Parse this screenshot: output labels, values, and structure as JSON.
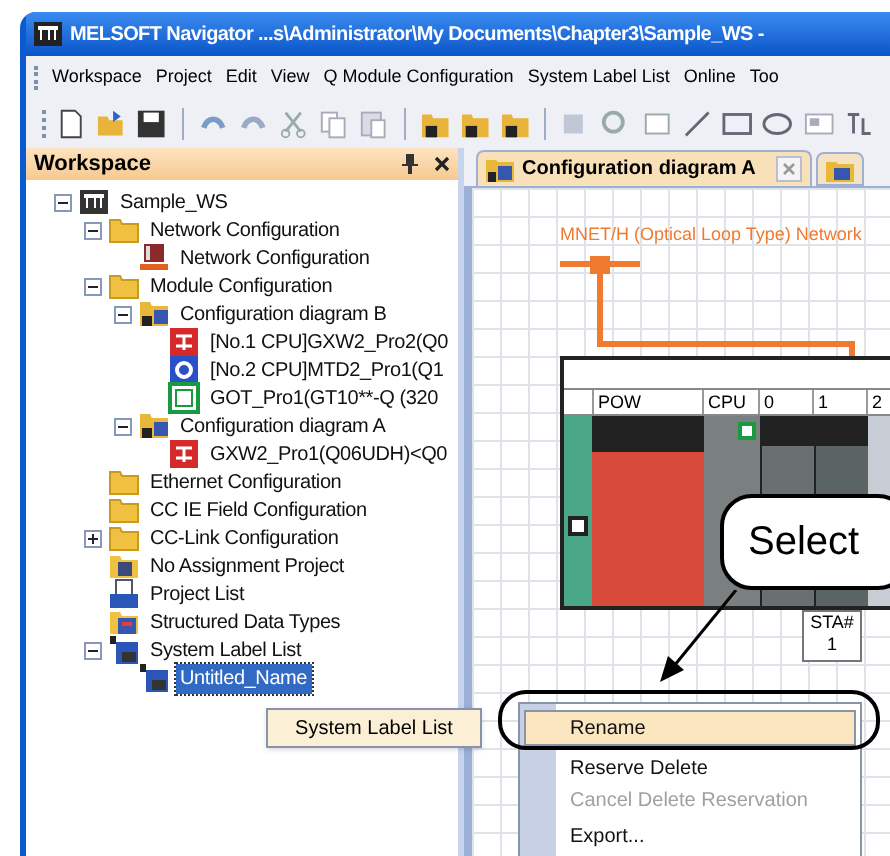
{
  "window": {
    "title": "MELSOFT Navigator ...s\\Administrator\\My Documents\\Chapter3\\Sample_WS -"
  },
  "menu": [
    "Workspace",
    "Project",
    "Edit",
    "View",
    "Q Module Configuration",
    "System Label List",
    "Online",
    "Too"
  ],
  "workspace": {
    "title": "Workspace",
    "tree": [
      {
        "label": "Sample_WS",
        "kind": "workspace",
        "expanded": true,
        "selected": false,
        "children": [
          {
            "label": "Network Configuration",
            "kind": "folder",
            "expanded": true,
            "selected": false,
            "children": [
              {
                "label": "Network Configuration",
                "kind": "network",
                "selected": false
              }
            ]
          },
          {
            "label": "Module Configuration",
            "kind": "folder",
            "expanded": true,
            "selected": false,
            "children": [
              {
                "label": "Configuration diagram B",
                "kind": "diagram",
                "expanded": true,
                "selected": false,
                "children": [
                  {
                    "label": "[No.1 CPU]GXW2_Pro2(Q0",
                    "kind": "plc",
                    "selected": false
                  },
                  {
                    "label": "[No.2 CPU]MTD2_Pro1(Q1",
                    "kind": "motion",
                    "selected": false
                  },
                  {
                    "label": "GOT_Pro1(GT10**-Q (320",
                    "kind": "got",
                    "selected": false
                  }
                ]
              },
              {
                "label": "Configuration diagram A",
                "kind": "diagram",
                "expanded": true,
                "selected": false,
                "children": [
                  {
                    "label": "GXW2_Pro1(Q06UDH)<Q0",
                    "kind": "plc",
                    "selected": false
                  }
                ]
              }
            ]
          },
          {
            "label": "Ethernet Configuration",
            "kind": "folder",
            "selected": false
          },
          {
            "label": "CC IE Field Configuration",
            "kind": "folder",
            "selected": false
          },
          {
            "label": "CC-Link Configuration",
            "kind": "folder",
            "expanded": false,
            "selected": false
          },
          {
            "label": "No Assignment Project",
            "kind": "unassigned",
            "selected": false
          },
          {
            "label": "Project List",
            "kind": "projects",
            "selected": false
          },
          {
            "label": "Structured Data Types",
            "kind": "structs",
            "selected": false
          },
          {
            "label": "System Label List",
            "kind": "labels",
            "expanded": true,
            "selected": false,
            "children": [
              {
                "label": "Untitled_Name",
                "kind": "labels",
                "selected": true
              }
            ]
          }
        ]
      }
    ]
  },
  "tabs": [
    {
      "label": "Configuration diagram A",
      "selected": true
    }
  ],
  "diagram": {
    "network_label": "MNET/H (Optical Loop Type) Network",
    "slots": [
      "POW",
      "CPU",
      "0",
      "1",
      "2"
    ],
    "station": {
      "label": "STA#",
      "number": "1"
    }
  },
  "tooltip": "System Label List",
  "context_menu": [
    {
      "label": "Rename",
      "selected": true,
      "disabled": false
    },
    {
      "label": "Reserve Delete",
      "selected": false,
      "disabled": false
    },
    {
      "label": "Cancel Delete Reservation",
      "selected": false,
      "disabled": true
    },
    {
      "label": "Export...",
      "selected": false,
      "disabled": false
    }
  ],
  "callout": "Select"
}
